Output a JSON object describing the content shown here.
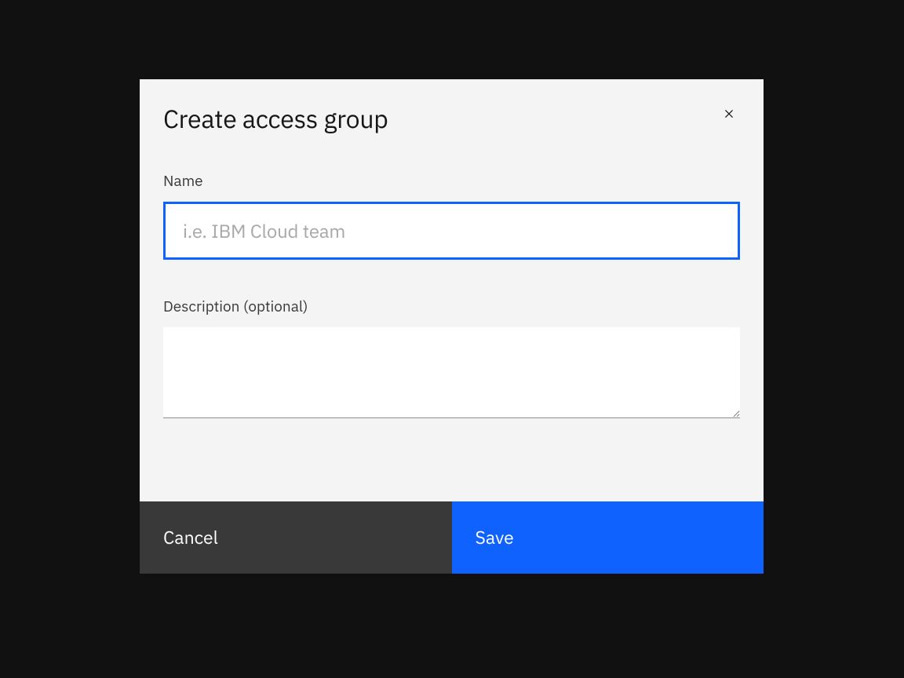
{
  "modal": {
    "title": "Create access group",
    "fields": {
      "name": {
        "label": "Name",
        "placeholder": "i.e. IBM Cloud team",
        "value": ""
      },
      "description": {
        "label": "Description (optional)",
        "value": ""
      }
    },
    "buttons": {
      "cancel_label": "Cancel",
      "save_label": "Save"
    }
  },
  "colors": {
    "accent": "#0f62fe",
    "secondary_button": "#393939",
    "modal_bg": "#f4f4f4",
    "page_bg": "#111111"
  }
}
